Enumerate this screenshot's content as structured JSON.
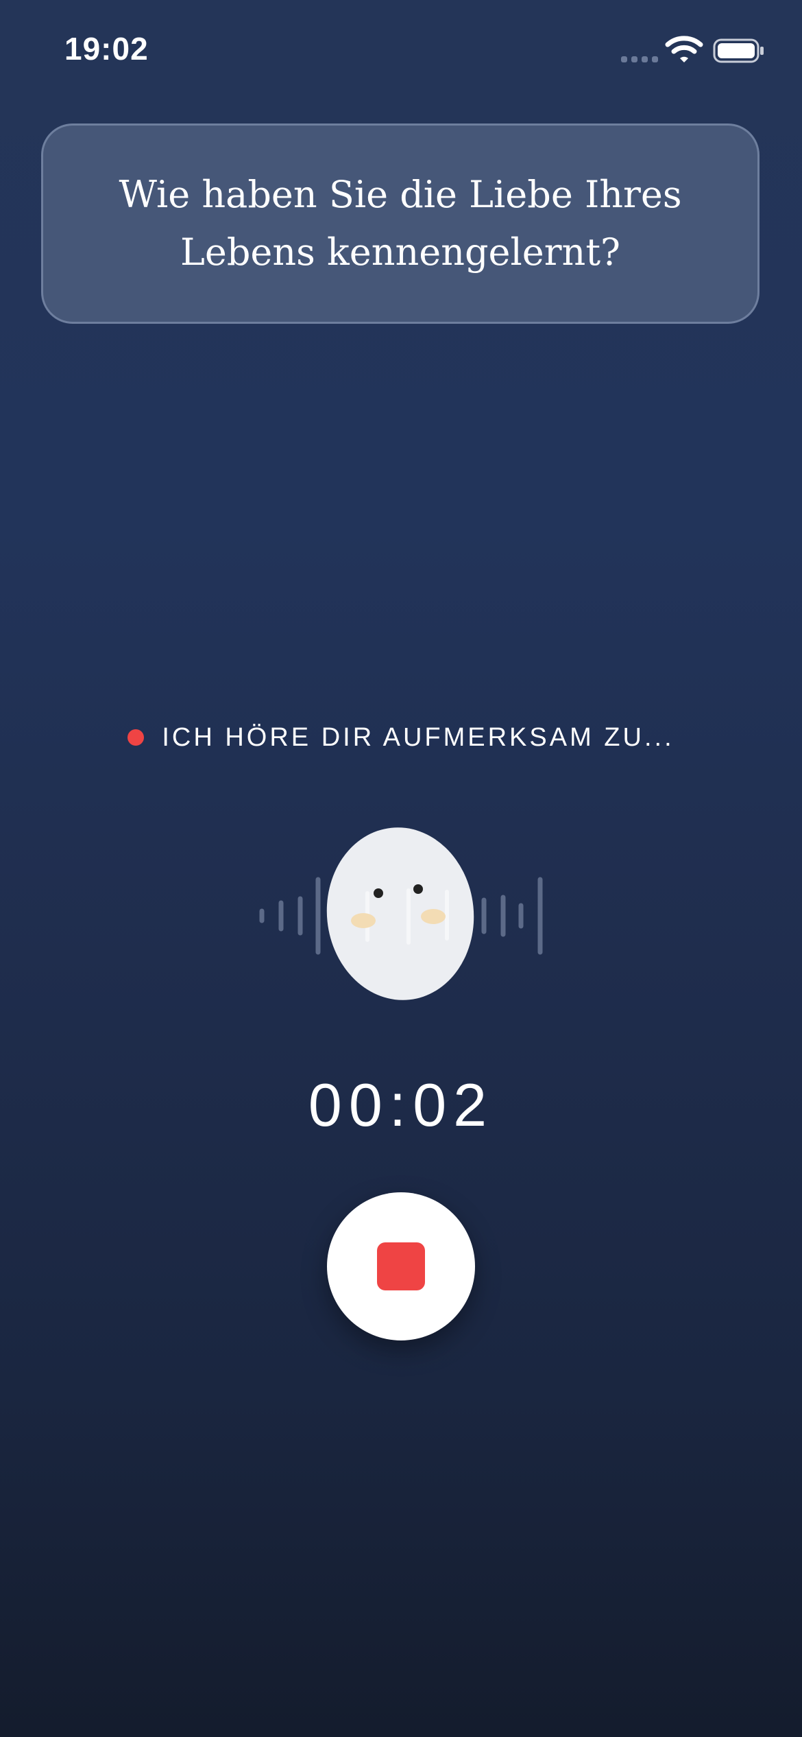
{
  "status_bar": {
    "time": "19:02",
    "icons": [
      "cellular-signal-icon",
      "wifi-icon",
      "battery-icon"
    ]
  },
  "question": {
    "text": "Wie haben Sie die Liebe Ihres Lebens kennengelernt?"
  },
  "recording": {
    "status_text": "ICH HÖRE DIR AUFMERKSAM ZU...",
    "timer": "00:02",
    "stop_button_icon": "stop-icon"
  },
  "mascot": {
    "icon": "egg-mascot-icon"
  },
  "colors": {
    "accent_red": "#ef4444",
    "background_top": "#243558",
    "background_bottom": "#141c2d",
    "card_background": "rgba(120,135,165,0.42)",
    "mascot_body": "#eceef2",
    "mascot_cheeks": "#f3dcb4"
  }
}
